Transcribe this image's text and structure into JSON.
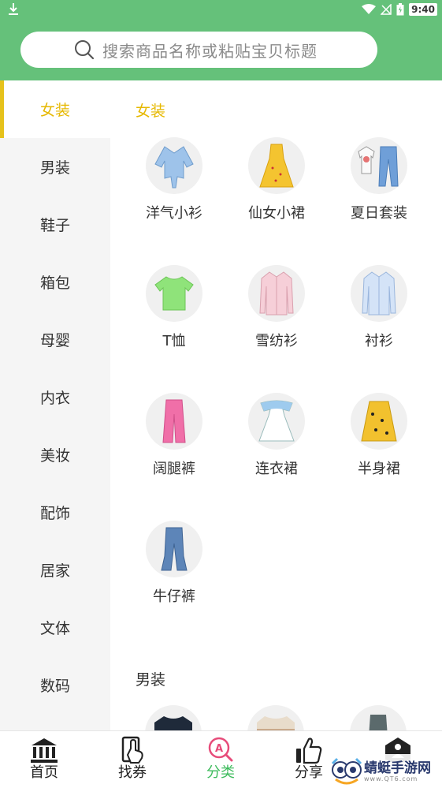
{
  "status_bar": {
    "time": "9:40"
  },
  "search": {
    "placeholder": "搜索商品名称或粘贴宝贝标题"
  },
  "sidebar": {
    "items": [
      {
        "label": "女装",
        "active": true
      },
      {
        "label": "男装"
      },
      {
        "label": "鞋子"
      },
      {
        "label": "箱包"
      },
      {
        "label": "母婴"
      },
      {
        "label": "内衣"
      },
      {
        "label": "美妆"
      },
      {
        "label": "配饰"
      },
      {
        "label": "居家"
      },
      {
        "label": "文体"
      },
      {
        "label": "数码"
      }
    ]
  },
  "content": {
    "women_title": "女装",
    "women_items": [
      {
        "label": "洋气小衫",
        "icon": "blouse-icon"
      },
      {
        "label": "仙女小裙",
        "icon": "yellow-dress-icon"
      },
      {
        "label": "夏日套装",
        "icon": "summer-set-icon"
      },
      {
        "label": "T恤",
        "icon": "tshirt-icon"
      },
      {
        "label": "雪纺衫",
        "icon": "chiffon-shirt-icon"
      },
      {
        "label": "衬衫",
        "icon": "shirt-icon"
      },
      {
        "label": "阔腿裤",
        "icon": "wide-pants-icon"
      },
      {
        "label": "连衣裙",
        "icon": "dress-icon"
      },
      {
        "label": "半身裙",
        "icon": "skirt-icon"
      },
      {
        "label": "牛仔裤",
        "icon": "jeans-icon"
      }
    ],
    "men_title": "男装"
  },
  "bottom_nav": {
    "items": [
      {
        "label": "首页",
        "icon": "home-icon"
      },
      {
        "label": "找券",
        "icon": "coupon-icon"
      },
      {
        "label": "分类",
        "icon": "category-icon",
        "active": true
      },
      {
        "label": "分享",
        "icon": "share-icon"
      },
      {
        "label": "",
        "icon": "profile-icon"
      }
    ]
  },
  "watermark": {
    "text": "蜻蜓手游网",
    "sub": "www.QT6.com"
  },
  "colors": {
    "header": "#65c17a",
    "accent": "#e6b800",
    "active_nav": "#3dbb5c"
  }
}
